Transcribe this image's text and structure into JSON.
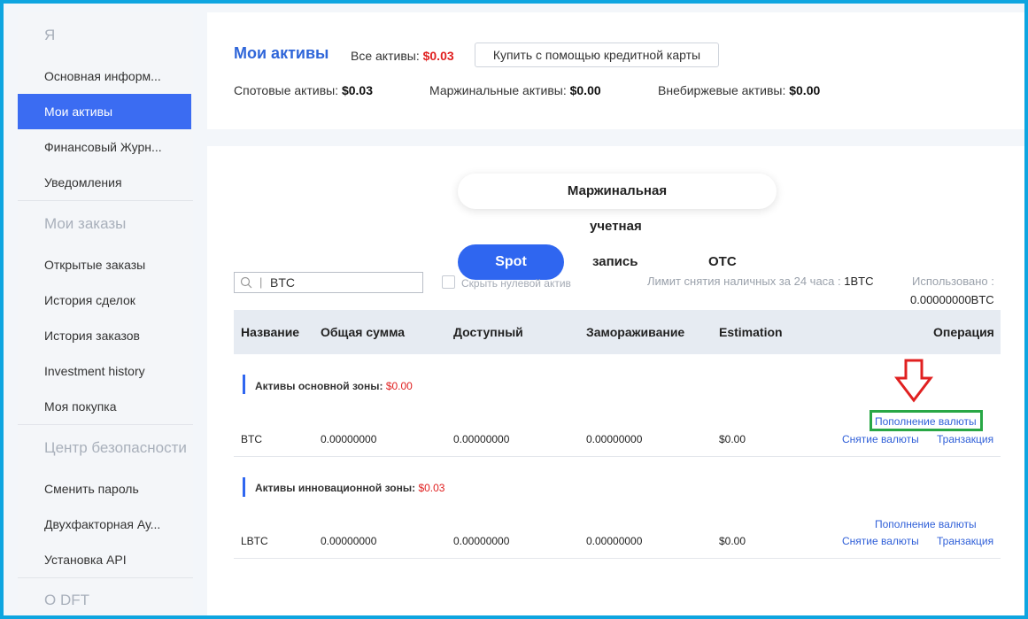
{
  "sidebar": {
    "section_me": "Я",
    "items_me": [
      "Основная информ...",
      "Мои активы",
      "Финансовый Журн...",
      "Уведомления"
    ],
    "section_orders": "Мои заказы",
    "items_orders": [
      "Открытые заказы",
      "История сделок",
      "История заказов",
      "Investment history",
      "Моя покупка"
    ],
    "section_security": "Центр безопасности",
    "items_security": [
      "Сменить пароль",
      "Двухфакторная Ау...",
      "Установка API"
    ],
    "section_about": "О DFT"
  },
  "summary": {
    "title": "Мои активы",
    "total_label": "Все активы:",
    "total_value": "$0.03",
    "buy_button": "Купить с помощью кредитной карты",
    "spot_label": "Спотовые активы:",
    "spot_value": "$0.03",
    "margin_label": "Маржинальные активы:",
    "margin_value": "$0.00",
    "otc_label": "Внебиржевые активы:",
    "otc_value": "$0.00"
  },
  "tabs": {
    "margin_line1": "Маржинальная",
    "margin_line2": "учетная",
    "margin_line3": "запись",
    "spot": "Spot",
    "otc": "OTC"
  },
  "filters": {
    "search_value": "BTC",
    "hide_zero_label": "Скрыть нулевой актив",
    "limit_label": "Лимит снятия наличных за 24 часа :",
    "limit_value": "1BTC",
    "used_label": "Использовано :",
    "used_value": "0.00000000BTC"
  },
  "table": {
    "headers": [
      "Название",
      "Общая сумма",
      "Доступный",
      "Замораживание",
      "Estimation",
      "Операция"
    ],
    "zones": [
      {
        "label": "Активы основной зоны:",
        "value": "$0.00",
        "row": {
          "name": "BTC",
          "total": "0.00000000",
          "available": "0.00000000",
          "frozen": "0.00000000",
          "estimation": "$0.00"
        }
      },
      {
        "label": "Активы инновационной зоны:",
        "value": "$0.03",
        "row": {
          "name": "LBTC",
          "total": "0.00000000",
          "available": "0.00000000",
          "frozen": "0.00000000",
          "estimation": "$0.00"
        }
      }
    ],
    "ops": {
      "deposit": "Пополнение валюты",
      "withdraw": "Снятие валюты",
      "transfer": "Транзакция"
    }
  },
  "colors": {
    "accent": "#2f66f0",
    "frame": "#0ea5e0",
    "highlight_box": "#28a745",
    "arrow": "#e02020"
  }
}
